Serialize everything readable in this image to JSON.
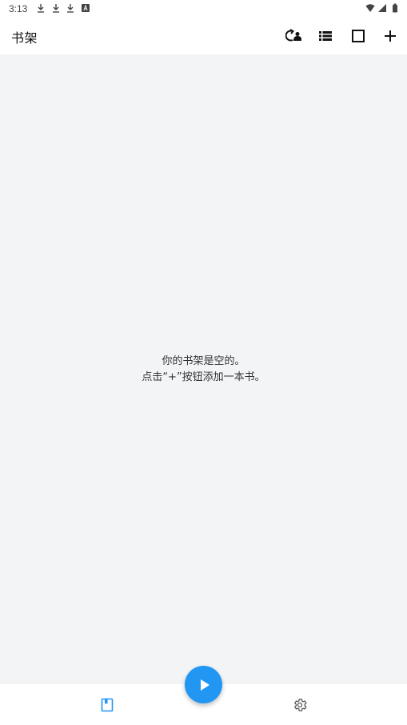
{
  "status_bar": {
    "time": "3:13",
    "icons": [
      "download-icon",
      "download-icon",
      "download-icon",
      "font-icon",
      "wifi-icon",
      "signal-icon",
      "battery-icon"
    ]
  },
  "app_bar": {
    "title": "书架",
    "actions": [
      "sync-icon",
      "list-view-icon",
      "square-icon",
      "add-icon"
    ]
  },
  "main": {
    "empty_line1": "你的书架是空的。",
    "empty_line2": "点击“+”按钮添加一本书。"
  },
  "bottom_nav": {
    "items": [
      "bookshelf-icon",
      "settings-icon"
    ],
    "active": "bookshelf-icon",
    "fab_icon": "play-icon"
  },
  "colors": {
    "accent": "#2196f3",
    "background": "#f3f4f6",
    "bar": "#ffffff"
  }
}
